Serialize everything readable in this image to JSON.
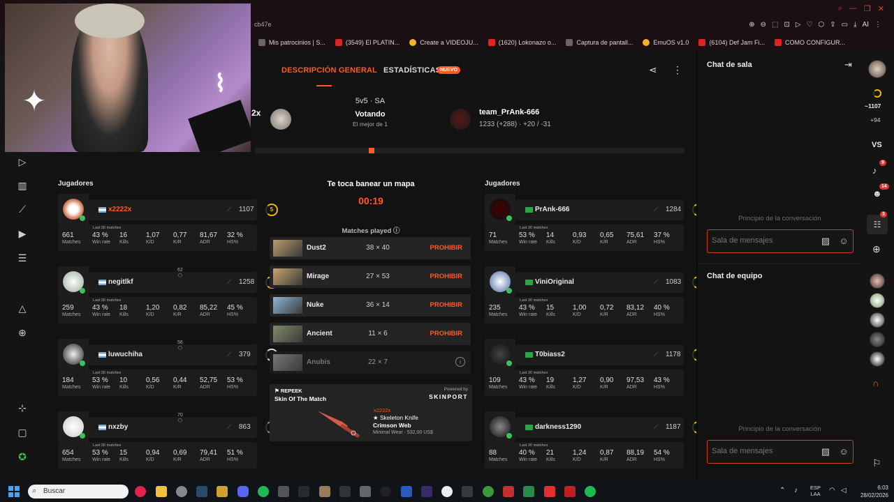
{
  "browser": {
    "url": "cb47e",
    "bookmarks": [
      "Mis patrocinios | S...",
      "(3549) El PLATIN...",
      "Create a VIDEOJU...",
      "(1620) Lokonazo o...",
      "Captura de pantall...",
      "EmuOS v1.0",
      "(6104) Def Jam Fi...",
      "COMO CONFIGUR..."
    ],
    "toolbar_ai": "AI"
  },
  "tabs": {
    "overview": "DESCRIPCIÓN GENERAL",
    "stats": "ESTADÍSTICAS",
    "new_badge": "NUEVO"
  },
  "match": {
    "format": "5v5 · SA",
    "status": "Votando",
    "best_of": "El mejor de 1",
    "left_team_partial": "2x",
    "right_team": "team_PrAnk-666",
    "right_team_stats": "1233 (+288)  ·  +20 / -31"
  },
  "players_title": "Jugadores",
  "ban": {
    "title": "Te toca banear un mapa",
    "timer": "00:19",
    "matches_played": "Matches played"
  },
  "maps": [
    {
      "name": "Dust2",
      "score": "38 × 40",
      "action": "PROHIBIR",
      "color": "#b89a6a"
    },
    {
      "name": "Mirage",
      "score": "27 × 53",
      "action": "PROHIBIR",
      "color": "#c9a36b"
    },
    {
      "name": "Nuke",
      "score": "36 × 14",
      "action": "PROHIBIR",
      "color": "#8fb6d6"
    },
    {
      "name": "Ancient",
      "score": "11 × 6",
      "action": "PROHIBIR",
      "color": "#7f8a6a"
    },
    {
      "name": "Anubis",
      "score": "22 × 7",
      "action": "",
      "color": "#777777"
    }
  ],
  "stat_labels": [
    "Matches",
    "Win rate",
    "Kills",
    "K/D",
    "K/R",
    "ADR",
    "HS%"
  ],
  "last30": "Last 30 matches",
  "left_players": [
    {
      "name": "x2222x",
      "elo": "1107",
      "level": "5",
      "party": "",
      "stats": [
        "661",
        "43 %",
        "16",
        "1,07",
        "0,77",
        "81,67",
        "32 %"
      ]
    },
    {
      "name": "negitlkf",
      "elo": "1258",
      "level": "6",
      "party": "62",
      "stats": [
        "259",
        "43 %",
        "18",
        "1,20",
        "0,82",
        "85,22",
        "45 %"
      ]
    },
    {
      "name": "luwuchiha",
      "elo": "379",
      "level": "1",
      "party": "56",
      "stats": [
        "184",
        "53 %",
        "10",
        "0,56",
        "0,44",
        "52,75",
        "53 %"
      ]
    },
    {
      "name": "nxzby",
      "elo": "863",
      "level": "3",
      "party": "70",
      "stats": [
        "654",
        "53 %",
        "15",
        "0,94",
        "0,69",
        "79,41",
        "51 %"
      ]
    }
  ],
  "right_players": [
    {
      "name": "PrAnk-666",
      "elo": "1284",
      "level": "6",
      "stats": [
        "71",
        "53 %",
        "14",
        "0,93",
        "0,65",
        "75,61",
        "37 %"
      ]
    },
    {
      "name": "ViniOriginal",
      "elo": "1083",
      "level": "5",
      "stats": [
        "235",
        "43 %",
        "15",
        "1,00",
        "0,72",
        "83,12",
        "40 %"
      ]
    },
    {
      "name": "T0biass2",
      "elo": "1178",
      "level": "5",
      "stats": [
        "109",
        "43 %",
        "19",
        "1,27",
        "0,90",
        "97,53",
        "43 %"
      ]
    },
    {
      "name": "darkness1290",
      "elo": "1187",
      "level": "5",
      "stats": [
        "88",
        "40 %",
        "21",
        "1,24",
        "0,87",
        "88,19",
        "54 %"
      ]
    }
  ],
  "skin": {
    "brand": "REPEEK",
    "title": "Skin Of The Match",
    "powered": "Powered by",
    "partner": "SKINPORT",
    "owner": "x2222x",
    "item": "★ Skeleton Knife",
    "finish": "Crimson Web",
    "condition": "Minimal Wear · 532,00 US$"
  },
  "chat": {
    "room_title": "Chat de sala",
    "team_title": "Chat de equipo",
    "empty": "Principio de la conversación",
    "placeholder": "Sala de mensajes"
  },
  "rail": {
    "points": "1107",
    "delta": "+94",
    "vs": "VS",
    "notif_badge": "9",
    "friends_badge": "14",
    "party_badge": "3"
  },
  "taskbar": {
    "search": "Buscar",
    "lang": "ESP",
    "lang2": "LAA",
    "time": "6:03",
    "date": "28/02/2026"
  }
}
